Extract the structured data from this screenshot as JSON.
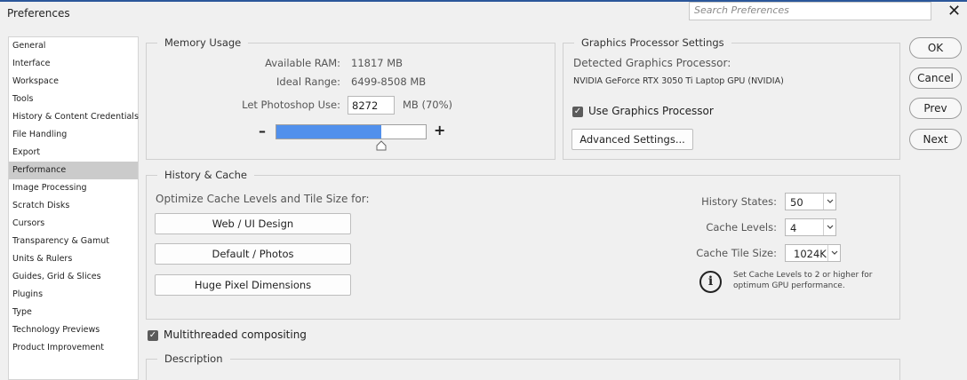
{
  "window": {
    "title": "Preferences",
    "close_glyph": "✕"
  },
  "search": {
    "placeholder": "Search Preferences"
  },
  "sidebar": {
    "active": "Performance",
    "items": [
      "General",
      "Interface",
      "Workspace",
      "Tools",
      "History & Content Credentials",
      "File Handling",
      "Export",
      "Performance",
      "Image Processing",
      "Scratch Disks",
      "Cursors",
      "Transparency & Gamut",
      "Units & Rulers",
      "Guides, Grid & Slices",
      "Plugins",
      "Type",
      "Technology Previews",
      "Product Improvement"
    ]
  },
  "memory": {
    "title": "Memory Usage",
    "available_label": "Available RAM:",
    "available_value": "11817 MB",
    "ideal_label": "Ideal Range:",
    "ideal_value": "6499-8508 MB",
    "let_label": "Let Photoshop Use:",
    "let_value": "8272",
    "let_suffix": "MB (70%)",
    "minus": "–",
    "plus": "+",
    "fraction": 0.7
  },
  "gpu": {
    "title": "Graphics Processor Settings",
    "detected_label": "Detected Graphics Processor:",
    "detected_value": "NVIDIA GeForce RTX 3050 Ti Laptop GPU (NVIDIA)",
    "use_label": "Use Graphics Processor",
    "use_checked": true,
    "advanced_button": "Advanced Settings..."
  },
  "cache": {
    "title": "History & Cache",
    "optimize_label": "Optimize Cache Levels and Tile Size for:",
    "buttons": [
      "Web / UI Design",
      "Default / Photos",
      "Huge Pixel Dimensions"
    ],
    "history_label": "History States:",
    "history_value": "50",
    "levels_label": "Cache Levels:",
    "levels_value": "4",
    "tile_label": "Cache Tile Size:",
    "tile_value": "1024K",
    "info_glyph": "i",
    "info_text": "Set Cache Levels to 2 or higher for optimum GPU performance."
  },
  "multithread": {
    "label": "Multithreaded compositing",
    "checked": true
  },
  "description": {
    "title": "Description"
  },
  "actions": {
    "ok": "OK",
    "cancel": "Cancel",
    "prev": "Prev",
    "next": "Next"
  },
  "colors": {
    "accent": "#5190ec",
    "active_item": "#cbcbcb",
    "topline": "#2b579a"
  }
}
